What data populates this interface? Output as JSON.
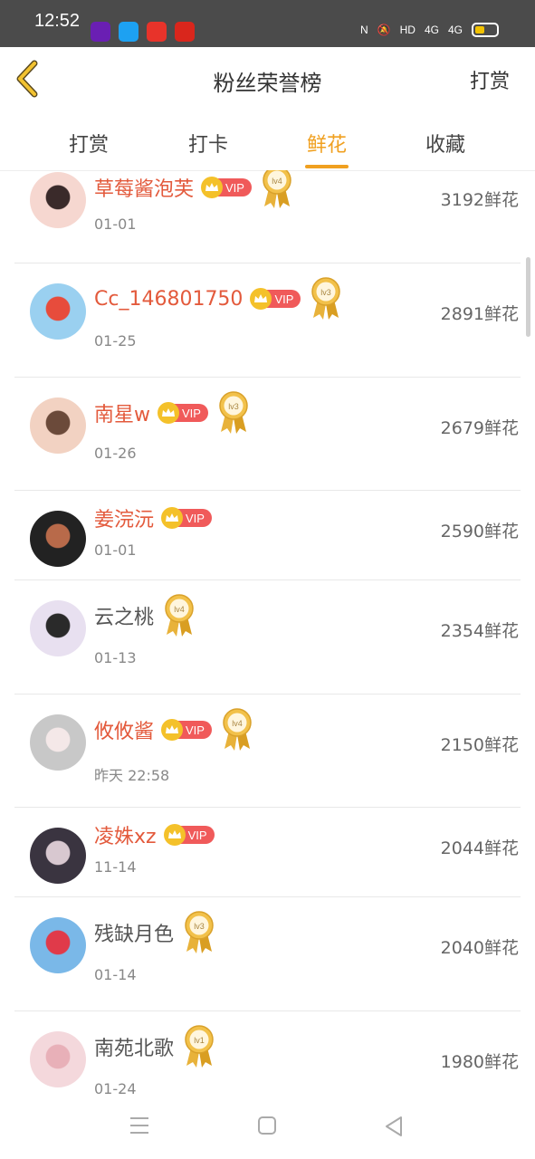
{
  "status_bar": {
    "time": "12:52",
    "network": "HD",
    "signal_1": "4G",
    "signal_2": "4G"
  },
  "header": {
    "title": "粉丝荣誉榜",
    "right_action": "打赏"
  },
  "tabs": [
    {
      "label": "打赏",
      "active": false
    },
    {
      "label": "打卡",
      "active": false
    },
    {
      "label": "鲜花",
      "active": true
    },
    {
      "label": "收藏",
      "active": false
    }
  ],
  "vip_label": "VIP",
  "entries": [
    {
      "name": "草莓酱泡芙",
      "vip": true,
      "level": "lv4",
      "date": "01-01",
      "count": "3192鲜花"
    },
    {
      "name": "Cc_146801750",
      "vip": true,
      "level": "lv3",
      "date": "01-25",
      "count": "2891鲜花"
    },
    {
      "name": "南星w",
      "vip": true,
      "level": "lv3",
      "date": "01-26",
      "count": "2679鲜花"
    },
    {
      "name": "姜浣沅",
      "vip": true,
      "level": "",
      "date": "01-01",
      "count": "2590鲜花"
    },
    {
      "name": "云之桃",
      "vip": false,
      "level": "lv4",
      "date": "01-13",
      "count": "2354鲜花"
    },
    {
      "name": "攸攸酱",
      "vip": true,
      "level": "lv4",
      "date": "昨天 22:58",
      "count": "2150鲜花"
    },
    {
      "name": "凌姝xz",
      "vip": true,
      "level": "",
      "date": "11-14",
      "count": "2044鲜花"
    },
    {
      "name": "残缺月色",
      "vip": false,
      "level": "lv3",
      "date": "01-14",
      "count": "2040鲜花"
    },
    {
      "name": "南苑北歌",
      "vip": false,
      "level": "lv1",
      "date": "01-24",
      "count": "1980鲜花"
    }
  ],
  "colors": {
    "accent": "#f0a020",
    "vip_name": "#e35a3c",
    "vip_badge": "#f05a5a",
    "status_bar": "#4b4b4b"
  }
}
